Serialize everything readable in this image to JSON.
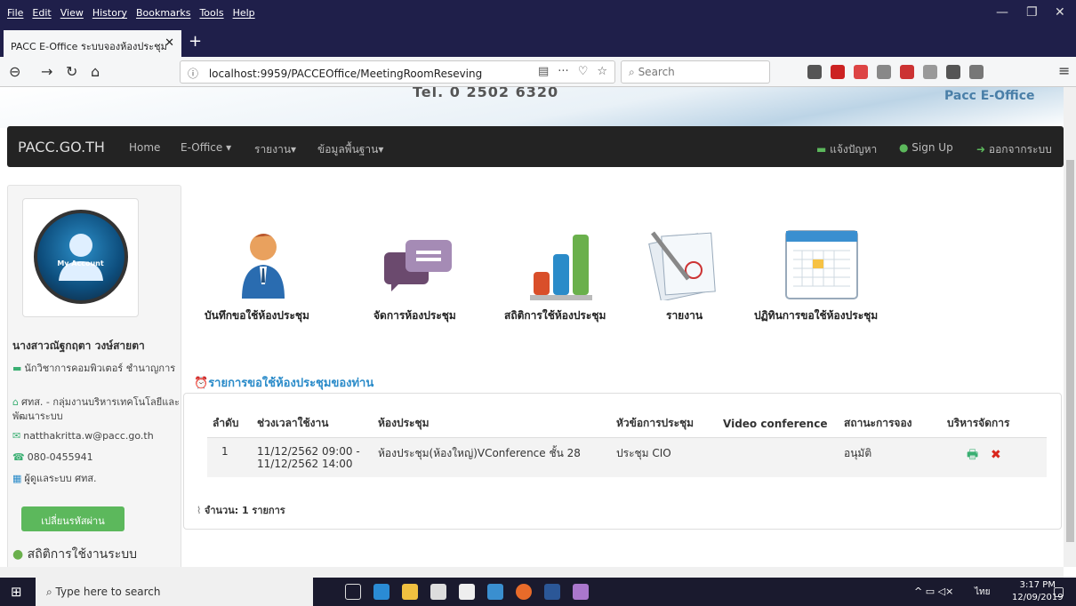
{
  "browser": {
    "menus": [
      "File",
      "Edit",
      "View",
      "History",
      "Bookmarks",
      "Tools",
      "Help"
    ],
    "tab_title": "PACC E-Office ระบบจองห้องประชุม",
    "url": "localhost:9959/PACCEOffice/MeetingRoomReseving",
    "search_placeholder": "Search"
  },
  "banner": {
    "tel": "Tel. 0 2502 6320",
    "brand": "Pacc E-Office"
  },
  "nav": {
    "logo": "PACC.GO.TH",
    "home": "Home",
    "eoffice": "E-Office ▾",
    "report": "รายงาน▾",
    "basedata": "ข้อมูลพื้นฐาน▾",
    "problem": "แจ้งปัญหา",
    "signup": "Sign Up",
    "logout": "ออกจากระบบ"
  },
  "profile": {
    "avatar_label": "My Account",
    "name": "นางสาวณัฐกฤตา วงษ์สายตา",
    "position": "นักวิชาการคอมพิวเตอร์ ชำนาญการ",
    "department": "ศทส. - กลุ่มงานบริหารเทคโนโลยีและพัฒนาระบบ",
    "email": "natthakritta.w@pacc.go.th",
    "phone": "080-0455941",
    "role": "ผู้ดูแลระบบ ศทส.",
    "change_password": "เปลี่ยนรหัสผ่าน",
    "stats": "สถิติการใช้งานระบบ"
  },
  "actions": [
    {
      "label": "บันทึกขอใช้ห้องประชุม"
    },
    {
      "label": "จัดการห้องประชุม"
    },
    {
      "label": "สถิติการใช้ห้องประชุม"
    },
    {
      "label": "รายงาน"
    },
    {
      "label": "ปฏิทินการขอใช้ห้องประชุม"
    }
  ],
  "list": {
    "title": "รายการขอใช้ห้องประชุมของท่าน",
    "headers": [
      "ลำดับ",
      "ช่วงเวลาใช้งาน",
      "ห้องประชุม",
      "หัวข้อการประชุม",
      "Video conference",
      "สถานะการจอง",
      "บริหารจัดการ"
    ],
    "rows": [
      {
        "no": "1",
        "time": "11/12/2562 09:00 - 11/12/2562 14:00",
        "room": "ห้องประชุม(ห้องใหญ่)VConference ชั้น 28",
        "topic": "ประชุม CIO",
        "video": "",
        "status": "อนุมัติ"
      }
    ],
    "count": "จำนวน: 1 รายการ"
  },
  "taskbar": {
    "search": "Type here to search",
    "time": "3:17 PM",
    "date": "12/09/2019",
    "lang": "ไทย"
  }
}
